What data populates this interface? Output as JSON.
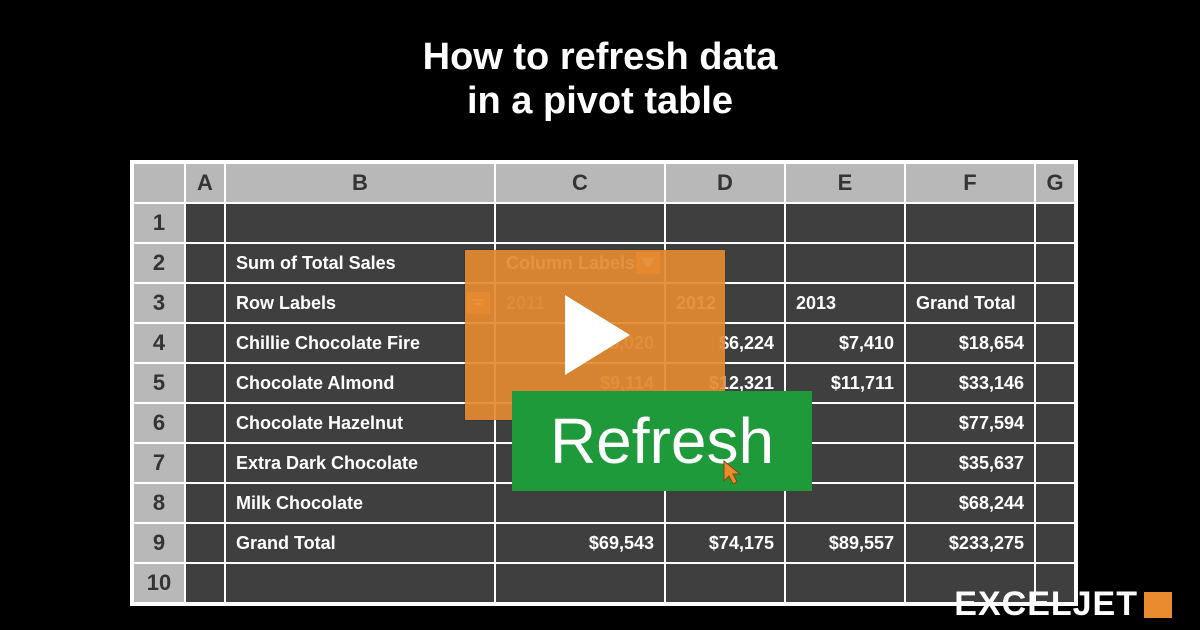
{
  "title_line1": "How to refresh data",
  "title_line2": "in a pivot table",
  "columns": {
    "A": "A",
    "B": "B",
    "C": "C",
    "D": "D",
    "E": "E",
    "F": "F",
    "G": "G"
  },
  "rownums": [
    "1",
    "2",
    "3",
    "4",
    "5",
    "6",
    "7",
    "8",
    "9",
    "10"
  ],
  "cells": {
    "B2": "Sum of Total Sales",
    "C2": "Column Labels",
    "B3": "Row Labels",
    "C3": "2011",
    "D3": "2012",
    "E3": "2013",
    "F3": "Grand Total",
    "B4": "Chillie Chocolate Fire",
    "C4": "$5,020",
    "D4": "$6,224",
    "E4": "$7,410",
    "F4": "$18,654",
    "B5": "Chocolate Almond",
    "C5": "$9,114",
    "D5": "$12,321",
    "E5": "$11,711",
    "F5": "$33,146",
    "B6": "Chocolate Hazelnut",
    "F6": "$77,594",
    "B7": "Extra Dark Chocolate",
    "F7": "$35,637",
    "B8": "Milk Chocolate",
    "F8": "$68,244",
    "B9": "Grand Total",
    "C9": "$69,543",
    "D9": "$74,175",
    "E9": "$89,557",
    "F9": "$233,275"
  },
  "refresh_label": "Refresh",
  "logo_text": "EXCELJET"
}
